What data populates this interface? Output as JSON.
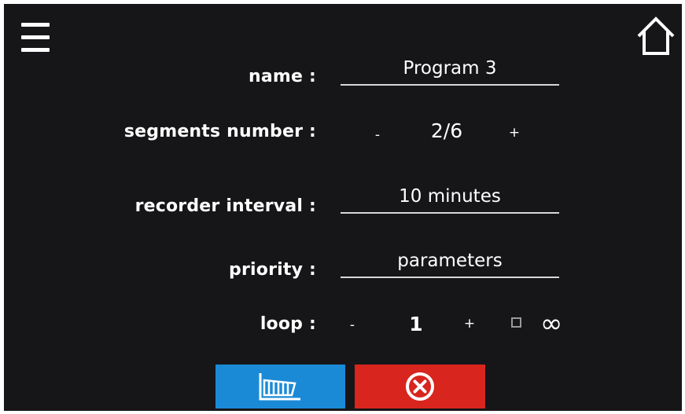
{
  "header": {
    "menu_icon": "hamburger-menu-icon",
    "home_icon": "home-icon"
  },
  "form": {
    "name": {
      "label": "name :",
      "value": "Program 3"
    },
    "segments": {
      "label": "segments number :",
      "decrement": "-",
      "value": "2/6",
      "increment": "+"
    },
    "recorder_interval": {
      "label": "recorder interval :",
      "value": "10 minutes"
    },
    "priority": {
      "label": "priority :",
      "value": "parameters"
    },
    "loop": {
      "label": "loop :",
      "decrement": "-",
      "value": "1",
      "increment": "+",
      "infinite_checked": false,
      "infinity_symbol": "∞"
    }
  },
  "actions": {
    "chart_button_icon": "segments-chart-icon",
    "cancel_button_icon": "close-circle-icon"
  },
  "colors": {
    "background": "#161618",
    "chart_button": "#1a8ad7",
    "cancel_button": "#d8251e",
    "text": "#ffffff"
  }
}
